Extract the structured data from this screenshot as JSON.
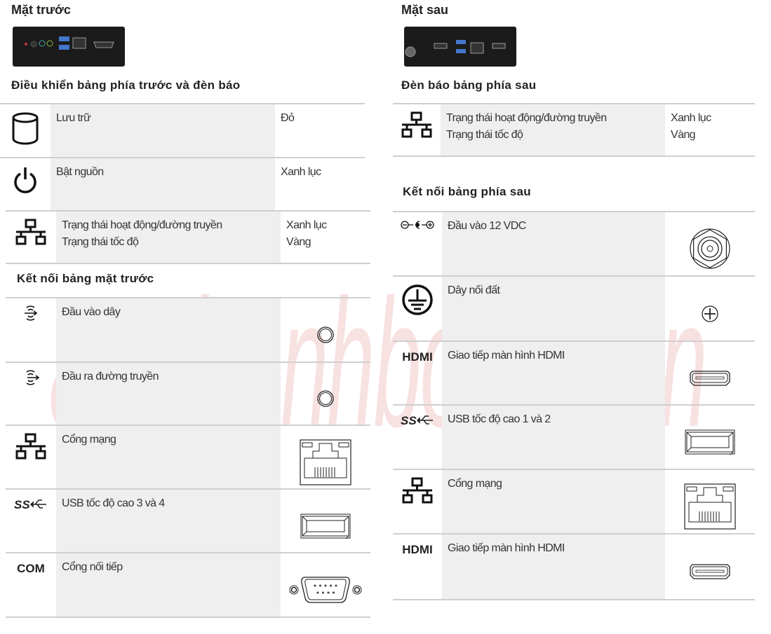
{
  "watermark": "amthanhbosch.vn",
  "front": {
    "title": "Mặt trước",
    "controls_heading": "Điều khiển bảng phía trước và đèn báo",
    "controls": [
      {
        "icon": "storage-icon",
        "label": "Lưu trữ",
        "value": "Đỏ"
      },
      {
        "icon": "power-icon",
        "label": "Bật nguồn",
        "value": "Xanh lục"
      },
      {
        "icon": "network-icon",
        "label": "Trạng thái hoạt động/đường truyền\nTrạng thái tốc độ",
        "value": "Xanh lục\nVàng"
      }
    ],
    "connections_heading": "Kết nối bảng mặt trước",
    "connections": [
      {
        "icon": "audio-in-icon",
        "label": "Đầu vào dây",
        "connector": "audio-jack-icon"
      },
      {
        "icon": "audio-out-icon",
        "label": "Đầu ra đường truyền",
        "connector": "audio-jack-icon"
      },
      {
        "icon": "network-icon",
        "label": "Cổng mạng",
        "connector": "rj45-port-icon"
      },
      {
        "icon": "usb-ss-icon",
        "label": "USB tốc độ cao 3 và 4",
        "connector": "usb-port-icon"
      },
      {
        "icon_text": "COM",
        "label": "Cổng nối tiếp",
        "connector": "db9-port-icon"
      }
    ]
  },
  "rear": {
    "title": "Mặt sau",
    "indicators_heading": "Đèn báo bảng phía sau",
    "indicators": [
      {
        "icon": "network-icon",
        "label": "Trạng thái hoạt động/đường truyền\nTrạng thái tốc độ",
        "value": "Xanh lục\nVàng"
      }
    ],
    "connections_heading": "Kết nối bảng phía sau",
    "connections": [
      {
        "icon": "dc-polarity-icon",
        "label": "Đầu vào 12 VDC",
        "connector": "dc-jack-icon"
      },
      {
        "icon": "ground-icon",
        "label": "Dây nối đất",
        "connector": "ground-screw-icon"
      },
      {
        "icon_text": "HDMI",
        "label": "Giao tiếp màn hình HDMI",
        "connector": "hdmi-port-icon"
      },
      {
        "icon": "usb-ss-icon",
        "label": "USB tốc độ cao 1 và 2",
        "connector": "usb-port-icon"
      },
      {
        "icon": "network-icon",
        "label": "Cổng mạng",
        "connector": "rj45-port-icon"
      },
      {
        "icon_text": "HDMI",
        "label": "Giao tiếp màn hình HDMI",
        "connector": "hdmi-port-icon"
      }
    ]
  }
}
